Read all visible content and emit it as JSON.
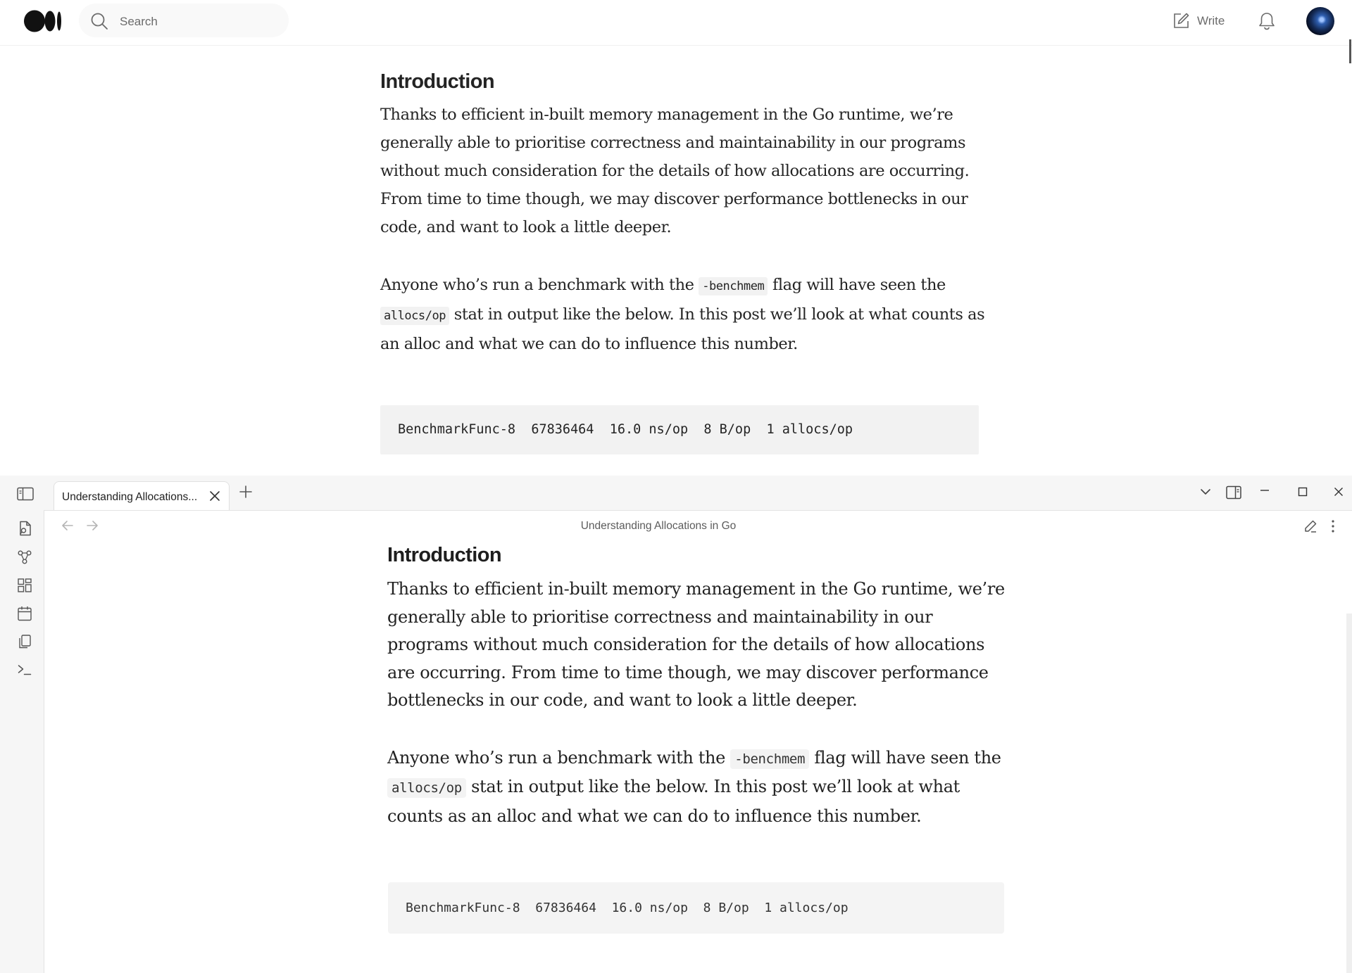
{
  "medium": {
    "search_placeholder": "Search",
    "write_label": "Write",
    "article": {
      "heading": "Introduction",
      "p1": "Thanks to efficient in-built memory management in the Go runtime, we’re generally able to prioritise correctness and maintainability in our programs without much consideration for the details of how allocations are occurring. From time to time though, we may discover performance bottlenecks in our code, and want to look a little deeper.",
      "p2_a": "Anyone who’s run a benchmark with the ",
      "p2_code1": "-benchmem",
      "p2_b": " flag will have seen the ",
      "p2_code2": "allocs/op",
      "p2_c": " stat in output like the below. In this post we’ll look at what counts as an alloc and what we can do to influence this number.",
      "code_block": "BenchmarkFunc-8  67836464  16.0 ns/op  8 B/op  1 allocs/op"
    }
  },
  "obsidian": {
    "tab_title": "Understanding Allocations...",
    "view_title": "Understanding Allocations in Go",
    "article": {
      "heading": "Introduction",
      "p1": "Thanks to efficient in-built memory management in the Go runtime, we’re generally able to prioritise correctness and maintainability in our programs without much consideration for the details of how allocations are occurring. From time to time though, we may discover performance bottlenecks in our code, and want to look a little deeper.",
      "p2_a": "Anyone who’s run a benchmark with the ",
      "p2_code1": "-benchmem",
      "p2_b": " flag will have seen the ",
      "p2_code2": "allocs/op",
      "p2_c": " stat in output like the below. In this post we’ll look at what counts as an alloc and what we can do to influence this number.",
      "code_block": "BenchmarkFunc-8  67836464  16.0 ns/op  8 B/op  1 allocs/op"
    }
  },
  "icons": {
    "medium_logo": "medium-logo",
    "search": "search-icon",
    "write": "write-icon",
    "notifications": "bell-icon",
    "sidebar_toggle": "sidebar-toggle-icon",
    "tab_close": "close-icon",
    "new_tab": "plus-icon",
    "tab_list": "chevron-down-icon",
    "split_view": "split-view-icon",
    "minimize": "minimize-icon",
    "maximize": "maximize-icon",
    "close_window": "close-icon",
    "ribbon": [
      "open-quick-switcher-icon",
      "graph-view-icon",
      "canvas-icon",
      "daily-note-icon",
      "templates-icon",
      "command-palette-icon"
    ],
    "back": "arrow-left-icon",
    "forward": "arrow-right-icon",
    "edit_mode": "pencil-icon",
    "more_options": "more-vertical-icon"
  }
}
